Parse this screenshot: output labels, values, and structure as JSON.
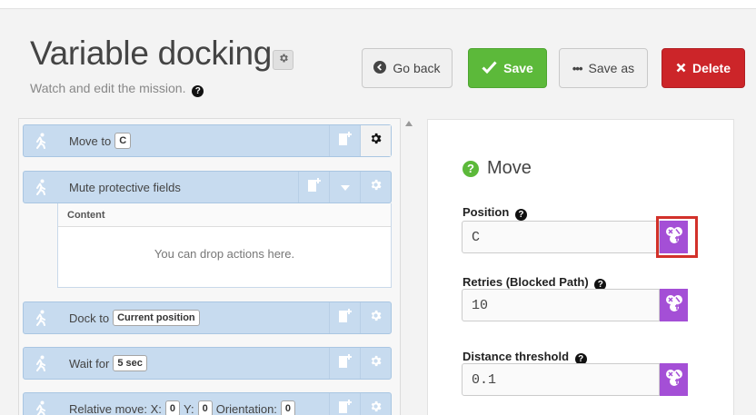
{
  "header": {
    "title": "Variable docking",
    "subtitle": "Watch and edit the mission."
  },
  "buttons": {
    "go_back": "Go back",
    "save": "Save",
    "save_as": "Save as",
    "delete": "Delete"
  },
  "actions": [
    {
      "label": "Move to",
      "params": [
        "C"
      ]
    },
    {
      "label": "Mute protective fields",
      "content_header": "Content",
      "content_drop": "You can drop actions here."
    },
    {
      "label": "Dock to",
      "params": [
        "Current position"
      ]
    },
    {
      "label": "Wait for",
      "params": [
        "5 sec"
      ]
    },
    {
      "label": "Relative move: X:",
      "params": [
        "0",
        "0",
        "0"
      ],
      "y_label": "Y:",
      "orientation_label": "Orientation:"
    }
  ],
  "editor": {
    "title": "Move",
    "fields": [
      {
        "label": "Position",
        "value": "C"
      },
      {
        "label": "Retries (Blocked Path)",
        "value": "10"
      },
      {
        "label": "Distance threshold",
        "value": "0.1"
      }
    ]
  },
  "colors": {
    "save": "#5cb93a",
    "delete": "#cc2529",
    "action_bg": "#c7dbef",
    "picker": "#a44fd6",
    "highlight": "#d2312a"
  }
}
